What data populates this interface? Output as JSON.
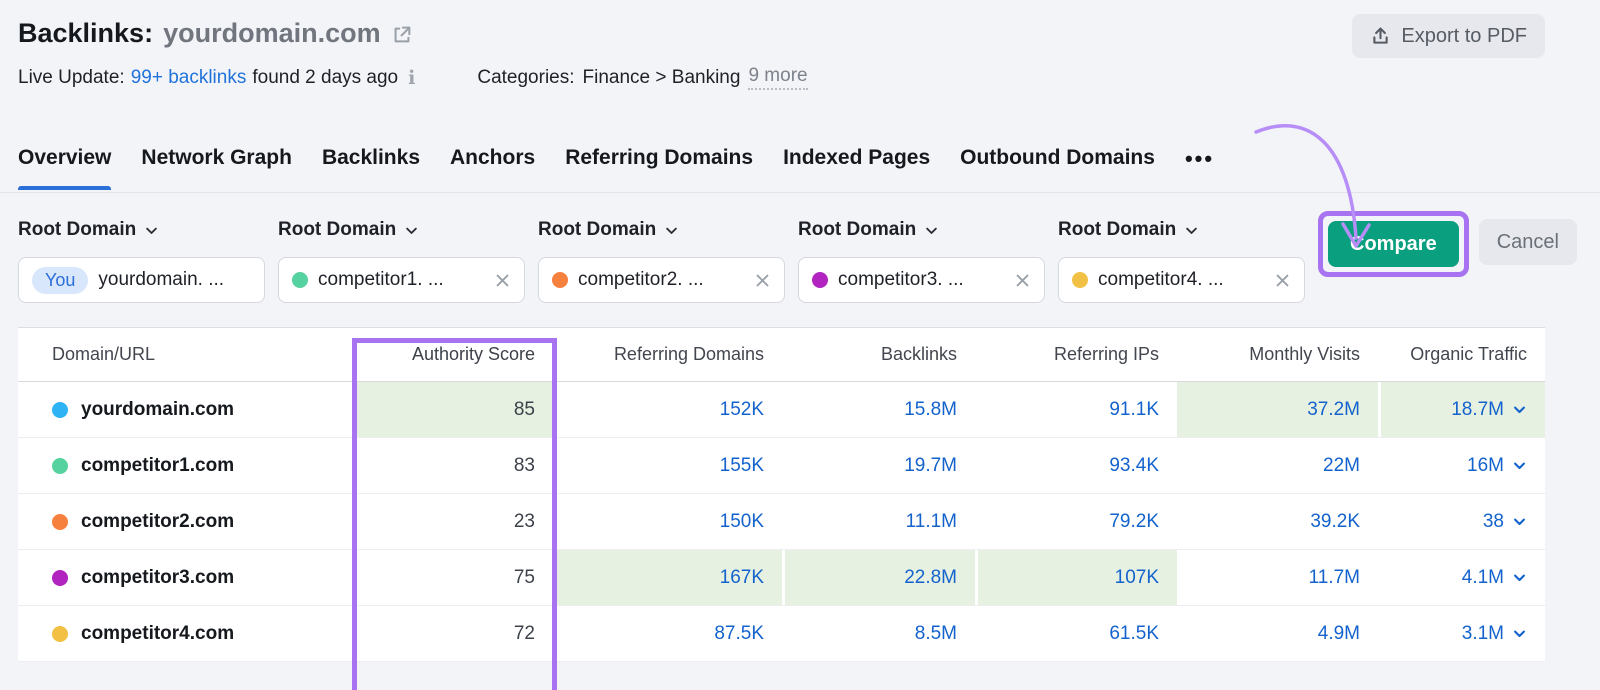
{
  "header": {
    "title": "Backlinks:",
    "domain": "yourdomain.com",
    "export_button": "Export to PDF"
  },
  "live_update": {
    "label": "Live Update:",
    "link": "99+ backlinks",
    "suffix": "found 2 days ago",
    "categories_label": "Categories:",
    "categories_path": "Finance > Banking",
    "more": "9 more"
  },
  "tabs": {
    "items": [
      {
        "label": "Overview",
        "active": true
      },
      {
        "label": "Network Graph",
        "active": false
      },
      {
        "label": "Backlinks",
        "active": false
      },
      {
        "label": "Anchors",
        "active": false
      },
      {
        "label": "Referring Domains",
        "active": false
      },
      {
        "label": "Indexed Pages",
        "active": false
      },
      {
        "label": "Outbound Domains",
        "active": false
      }
    ],
    "more_icon": "•••"
  },
  "filters": {
    "dropdown_label": "Root Domain",
    "targets": [
      {
        "badge": "You",
        "label": "yourdomain. ...",
        "dot_color": "",
        "removable": false
      },
      {
        "badge": "",
        "label": "competitor1. ...",
        "dot_color": "#55d29f",
        "removable": true
      },
      {
        "badge": "",
        "label": "competitor2. ...",
        "dot_color": "#f6803e",
        "removable": true
      },
      {
        "badge": "",
        "label": "competitor3. ...",
        "dot_color": "#b124c0",
        "removable": true
      },
      {
        "badge": "",
        "label": "competitor4. ...",
        "dot_color": "#f2c144",
        "removable": true
      }
    ],
    "compare_button": "Compare",
    "cancel_button": "Cancel"
  },
  "table": {
    "columns": [
      "Domain/URL",
      "Authority Score",
      "Referring Domains",
      "Backlinks",
      "Referring IPs",
      "Monthly Visits",
      "Organic Traffic"
    ],
    "rows": [
      {
        "domain": "yourdomain.com",
        "dot_color": "#2eb4f4",
        "authority_score": "85",
        "referring_domains": "152K",
        "backlinks": "15.8M",
        "referring_ips": "91.1K",
        "monthly_visits": "37.2M",
        "organic_traffic": "18.7M",
        "highlighted": [
          "authority_score",
          "monthly_visits",
          "organic_traffic"
        ]
      },
      {
        "domain": "competitor1.com",
        "dot_color": "#55d29f",
        "authority_score": "83",
        "referring_domains": "155K",
        "backlinks": "19.7M",
        "referring_ips": "93.4K",
        "monthly_visits": "22M",
        "organic_traffic": "16M",
        "highlighted": []
      },
      {
        "domain": "competitor2.com",
        "dot_color": "#f6803e",
        "authority_score": "23",
        "referring_domains": "150K",
        "backlinks": "11.1M",
        "referring_ips": "79.2K",
        "monthly_visits": "39.2K",
        "organic_traffic": "38",
        "highlighted": []
      },
      {
        "domain": "competitor3.com",
        "dot_color": "#b124c0",
        "authority_score": "75",
        "referring_domains": "167K",
        "backlinks": "22.8M",
        "referring_ips": "107K",
        "monthly_visits": "11.7M",
        "organic_traffic": "4.1M",
        "highlighted": [
          "referring_domains",
          "backlinks",
          "referring_ips"
        ]
      },
      {
        "domain": "competitor4.com",
        "dot_color": "#f2c144",
        "authority_score": "72",
        "referring_domains": "87.5K",
        "backlinks": "8.5M",
        "referring_ips": "61.5K",
        "monthly_visits": "4.9M",
        "organic_traffic": "3.1M",
        "highlighted": []
      }
    ]
  },
  "colors": {
    "accent_blue": "#2b6fd9",
    "link_blue": "#1463cc",
    "green_highlight": "#e7f1e2",
    "purple_annotation": "#a873f0",
    "compare_green": "#0a9f7e"
  }
}
